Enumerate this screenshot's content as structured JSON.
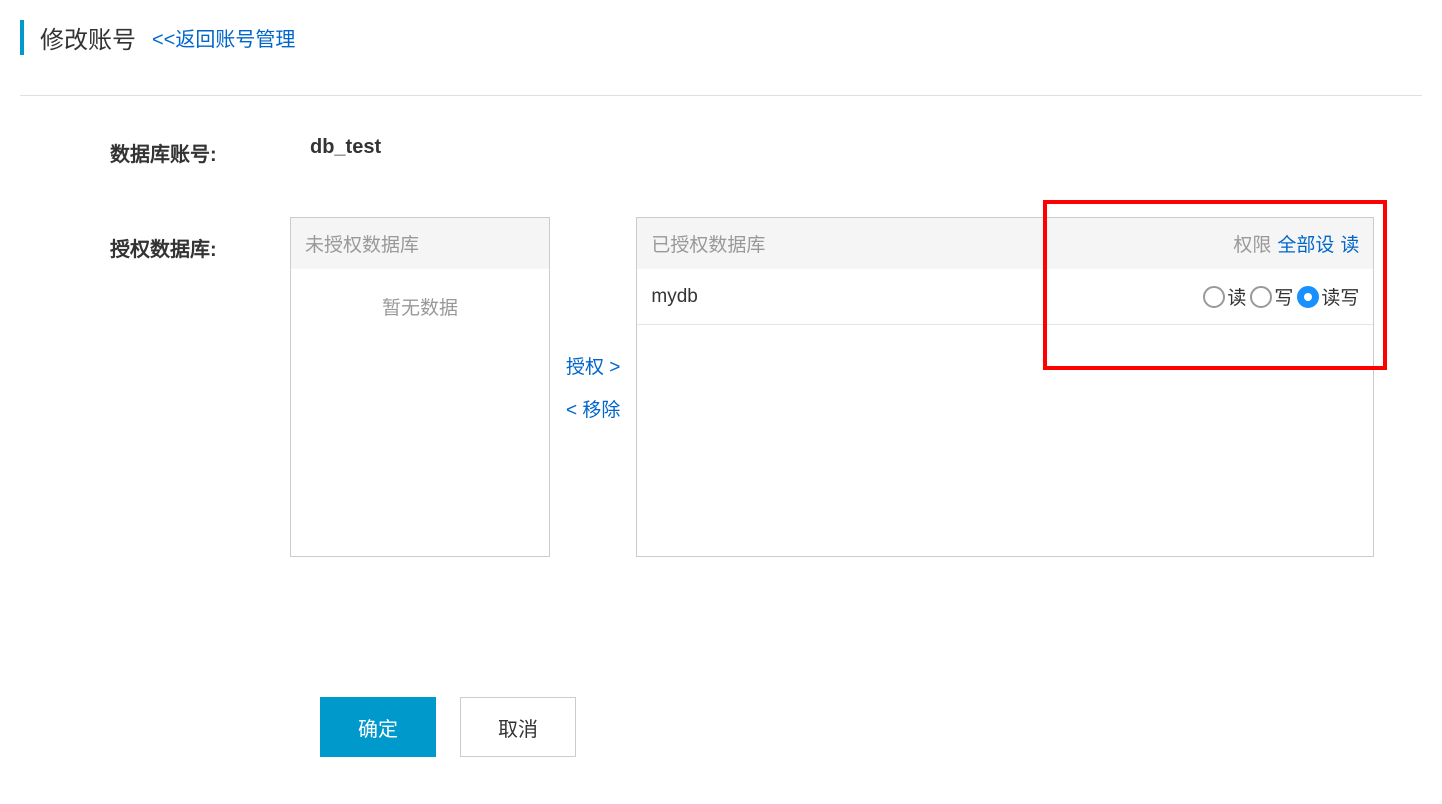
{
  "header": {
    "title": "修改账号",
    "back_link": "<<返回账号管理"
  },
  "form": {
    "account_label": "数据库账号:",
    "account_value": "db_test",
    "authorize_label": "授权数据库:"
  },
  "left_panel": {
    "header": "未授权数据库",
    "no_data": "暂无数据"
  },
  "transfer": {
    "authorize": "授权 >",
    "remove": "< 移除"
  },
  "right_panel": {
    "header": "已授权数据库",
    "perm_label": "权限",
    "set_all": "全部设",
    "read": "读",
    "items": [
      {
        "name": "mydb",
        "options": {
          "read": "读",
          "write": "写",
          "readwrite": "读写"
        },
        "selected": "readwrite"
      }
    ]
  },
  "actions": {
    "confirm": "确定",
    "cancel": "取消"
  }
}
